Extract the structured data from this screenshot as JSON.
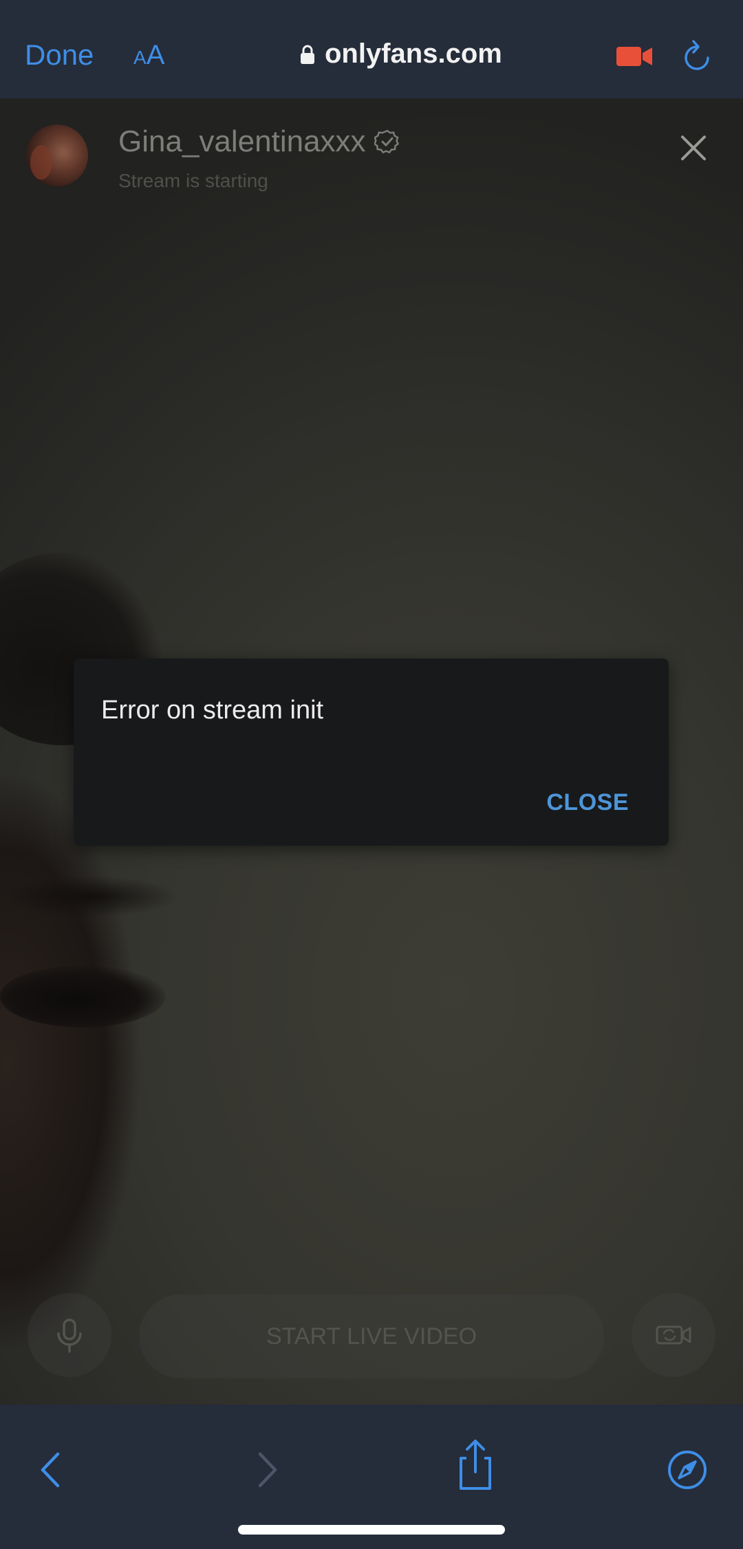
{
  "browser": {
    "done_label": "Done",
    "text_size_label_small": "A",
    "text_size_label_large": "A",
    "domain": "onlyfans.com",
    "icons": {
      "lock": "lock-icon",
      "camera": "video-camera-icon",
      "reload": "reload-icon"
    },
    "accent_color": "#3e8ee6",
    "camera_color": "#e8503a"
  },
  "stream": {
    "username": "Gina_valentinaxxx",
    "status": "Stream is starting",
    "start_button_label": "START LIVE VIDEO",
    "icons": {
      "verified": "verified-badge-icon",
      "close": "close-icon",
      "mic": "microphone-icon",
      "flip": "camera-flip-icon"
    }
  },
  "dialog": {
    "message": "Error on stream init",
    "close_label": "CLOSE",
    "button_color": "#4d95d9"
  },
  "toolbar": {
    "icons": [
      "back-icon",
      "forward-icon",
      "share-icon",
      "compass-icon"
    ]
  }
}
